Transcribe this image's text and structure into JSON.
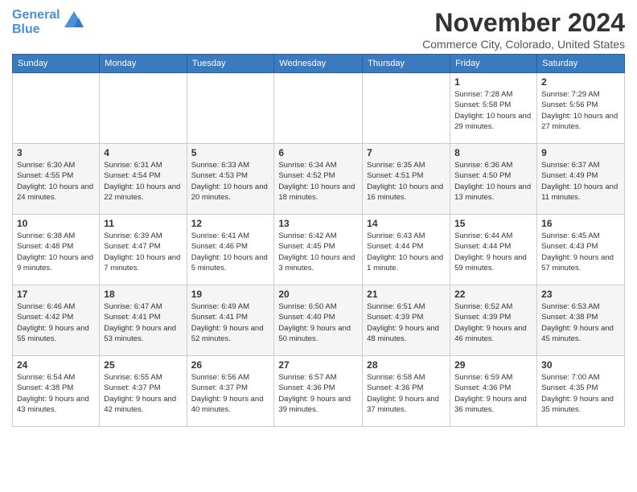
{
  "header": {
    "logo_line1": "General",
    "logo_line2": "Blue",
    "month_title": "November 2024",
    "location": "Commerce City, Colorado, United States"
  },
  "weekdays": [
    "Sunday",
    "Monday",
    "Tuesday",
    "Wednesday",
    "Thursday",
    "Friday",
    "Saturday"
  ],
  "weeks": [
    [
      {
        "day": "",
        "info": ""
      },
      {
        "day": "",
        "info": ""
      },
      {
        "day": "",
        "info": ""
      },
      {
        "day": "",
        "info": ""
      },
      {
        "day": "",
        "info": ""
      },
      {
        "day": "1",
        "info": "Sunrise: 7:28 AM\nSunset: 5:58 PM\nDaylight: 10 hours and 29 minutes."
      },
      {
        "day": "2",
        "info": "Sunrise: 7:29 AM\nSunset: 5:56 PM\nDaylight: 10 hours and 27 minutes."
      }
    ],
    [
      {
        "day": "3",
        "info": "Sunrise: 6:30 AM\nSunset: 4:55 PM\nDaylight: 10 hours and 24 minutes."
      },
      {
        "day": "4",
        "info": "Sunrise: 6:31 AM\nSunset: 4:54 PM\nDaylight: 10 hours and 22 minutes."
      },
      {
        "day": "5",
        "info": "Sunrise: 6:33 AM\nSunset: 4:53 PM\nDaylight: 10 hours and 20 minutes."
      },
      {
        "day": "6",
        "info": "Sunrise: 6:34 AM\nSunset: 4:52 PM\nDaylight: 10 hours and 18 minutes."
      },
      {
        "day": "7",
        "info": "Sunrise: 6:35 AM\nSunset: 4:51 PM\nDaylight: 10 hours and 16 minutes."
      },
      {
        "day": "8",
        "info": "Sunrise: 6:36 AM\nSunset: 4:50 PM\nDaylight: 10 hours and 13 minutes."
      },
      {
        "day": "9",
        "info": "Sunrise: 6:37 AM\nSunset: 4:49 PM\nDaylight: 10 hours and 11 minutes."
      }
    ],
    [
      {
        "day": "10",
        "info": "Sunrise: 6:38 AM\nSunset: 4:48 PM\nDaylight: 10 hours and 9 minutes."
      },
      {
        "day": "11",
        "info": "Sunrise: 6:39 AM\nSunset: 4:47 PM\nDaylight: 10 hours and 7 minutes."
      },
      {
        "day": "12",
        "info": "Sunrise: 6:41 AM\nSunset: 4:46 PM\nDaylight: 10 hours and 5 minutes."
      },
      {
        "day": "13",
        "info": "Sunrise: 6:42 AM\nSunset: 4:45 PM\nDaylight: 10 hours and 3 minutes."
      },
      {
        "day": "14",
        "info": "Sunrise: 6:43 AM\nSunset: 4:44 PM\nDaylight: 10 hours and 1 minute."
      },
      {
        "day": "15",
        "info": "Sunrise: 6:44 AM\nSunset: 4:44 PM\nDaylight: 9 hours and 59 minutes."
      },
      {
        "day": "16",
        "info": "Sunrise: 6:45 AM\nSunset: 4:43 PM\nDaylight: 9 hours and 57 minutes."
      }
    ],
    [
      {
        "day": "17",
        "info": "Sunrise: 6:46 AM\nSunset: 4:42 PM\nDaylight: 9 hours and 55 minutes."
      },
      {
        "day": "18",
        "info": "Sunrise: 6:47 AM\nSunset: 4:41 PM\nDaylight: 9 hours and 53 minutes."
      },
      {
        "day": "19",
        "info": "Sunrise: 6:49 AM\nSunset: 4:41 PM\nDaylight: 9 hours and 52 minutes."
      },
      {
        "day": "20",
        "info": "Sunrise: 6:50 AM\nSunset: 4:40 PM\nDaylight: 9 hours and 50 minutes."
      },
      {
        "day": "21",
        "info": "Sunrise: 6:51 AM\nSunset: 4:39 PM\nDaylight: 9 hours and 48 minutes."
      },
      {
        "day": "22",
        "info": "Sunrise: 6:52 AM\nSunset: 4:39 PM\nDaylight: 9 hours and 46 minutes."
      },
      {
        "day": "23",
        "info": "Sunrise: 6:53 AM\nSunset: 4:38 PM\nDaylight: 9 hours and 45 minutes."
      }
    ],
    [
      {
        "day": "24",
        "info": "Sunrise: 6:54 AM\nSunset: 4:38 PM\nDaylight: 9 hours and 43 minutes."
      },
      {
        "day": "25",
        "info": "Sunrise: 6:55 AM\nSunset: 4:37 PM\nDaylight: 9 hours and 42 minutes."
      },
      {
        "day": "26",
        "info": "Sunrise: 6:56 AM\nSunset: 4:37 PM\nDaylight: 9 hours and 40 minutes."
      },
      {
        "day": "27",
        "info": "Sunrise: 6:57 AM\nSunset: 4:36 PM\nDaylight: 9 hours and 39 minutes."
      },
      {
        "day": "28",
        "info": "Sunrise: 6:58 AM\nSunset: 4:36 PM\nDaylight: 9 hours and 37 minutes."
      },
      {
        "day": "29",
        "info": "Sunrise: 6:59 AM\nSunset: 4:36 PM\nDaylight: 9 hours and 36 minutes."
      },
      {
        "day": "30",
        "info": "Sunrise: 7:00 AM\nSunset: 4:35 PM\nDaylight: 9 hours and 35 minutes."
      }
    ]
  ]
}
